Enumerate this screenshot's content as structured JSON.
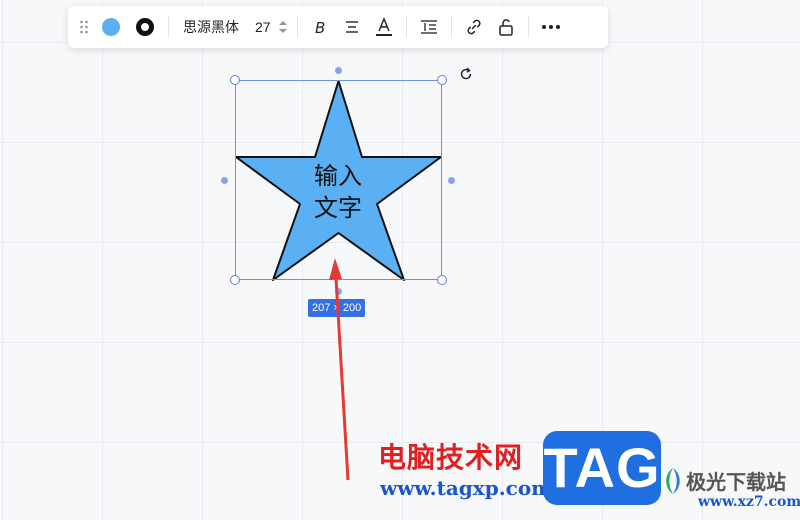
{
  "toolbar": {
    "font_name": "思源黑体",
    "font_size": "27",
    "fill_color": "#5ab0f2",
    "stroke_color": "#111111",
    "icons": [
      "drag-handle-icon",
      "fill-color-icon",
      "stroke-color-icon",
      "bold-icon",
      "align-icon",
      "text-color-icon",
      "line-spacing-icon",
      "link-icon",
      "unlock-icon",
      "more-icon"
    ]
  },
  "shape": {
    "type": "star",
    "text": [
      "输入",
      "文字"
    ],
    "fill": "#5ab0f2",
    "stroke": "#111111",
    "size_label": "207 × 200"
  },
  "colors": {
    "selection": "#6f8ee8",
    "arrow": "#e53935"
  },
  "watermark": {
    "cn_title": "电脑技术网",
    "url": "www.tagxp.com",
    "tag": "TAG",
    "site_cn": "极光下载站",
    "site_url": "www.xz7.com"
  }
}
